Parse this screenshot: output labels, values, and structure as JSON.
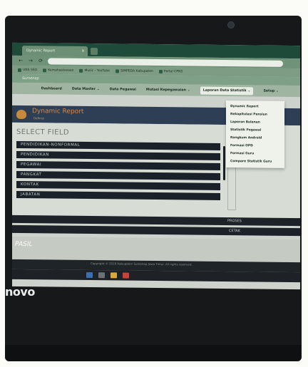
{
  "browser": {
    "tab_title": "Dynamic Report",
    "tab_close": "×",
    "address": "",
    "nav_back": "←",
    "nav_forward": "→",
    "nav_reload": "⟳",
    "bookmarks": [
      "UNS SSO",
      "Kemahasiswaan",
      "Music - YouTube",
      "SIMPEDA Kabupaten",
      "Portal CPNS"
    ]
  },
  "site": {
    "brand": "Sumenep"
  },
  "menu": {
    "items": [
      "Dashboard",
      "Data Master ⌄",
      "Data Pegawai",
      "Mutasi Kepegawaian ⌄",
      "Laporan Data Statistik ⌄",
      "Setup ⌄"
    ]
  },
  "dropdown": {
    "items": [
      "Dynamic Report",
      "Rekapitulasi Pensiun",
      "Laporan Bulanan",
      "Statistik Pegawai",
      "Rangkum Android",
      "Formasi OPD",
      "Formasi Guru",
      "Compare Statistik Guru"
    ]
  },
  "header": {
    "title": "Dynamic Report",
    "subtitle": "Definisi"
  },
  "select_field": {
    "title": "SELECT FIELD",
    "fields": [
      "PENDIDIKAN-NONFORMAL",
      "PENDIDIKAN",
      "PEGAWAI",
      "PANGKAT",
      "KONTAK",
      "JABATAN"
    ]
  },
  "buttons": {
    "proses": "PROSES",
    "cetak": "CETAK"
  },
  "lower": {
    "label": "PASIL",
    "copyright": "Copyright © 2018 Kabupaten Sumenep Jawa Timur. All rights reserved."
  },
  "device": {
    "brand": "novo"
  },
  "colors": {
    "header_bg": "#2e3f55",
    "logo_accent": "#d68a48",
    "field_bg": "#1a2128"
  }
}
